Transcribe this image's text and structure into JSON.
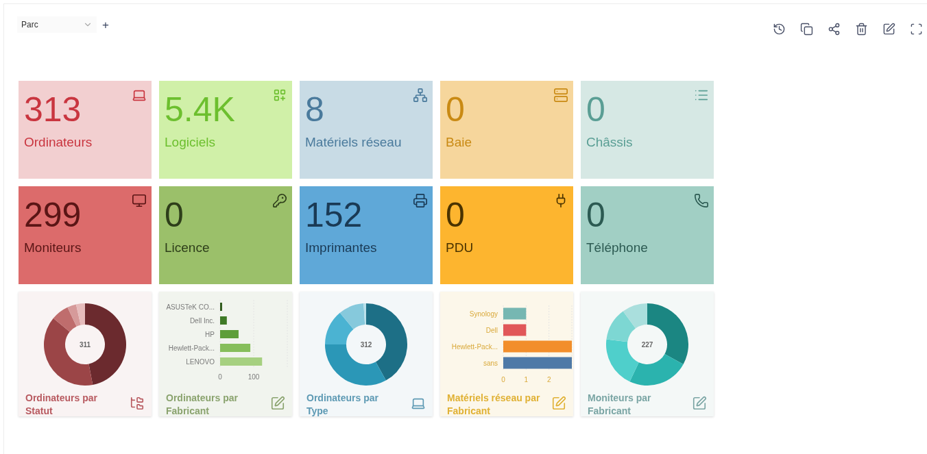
{
  "toolbar": {
    "dashboard_select": {
      "value": "Parc"
    },
    "add_button": "+"
  },
  "counters": [
    {
      "value": "313",
      "label": "Ordinateurs",
      "color": "#f2cfd0"
    },
    {
      "value": "5.4K",
      "label": "Logiciels",
      "color": "#d0f0a8"
    },
    {
      "value": "8",
      "label": "Matériels réseau",
      "color": "#c8dbe5"
    },
    {
      "value": "0",
      "label": "Baie",
      "color": "#f6d69c"
    },
    {
      "value": "0",
      "label": "Châssis",
      "color": "#d6e8e4"
    },
    {
      "value": "299",
      "label": "Moniteurs",
      "color": "#dc6b6b"
    },
    {
      "value": "0",
      "label": "Licence",
      "color": "#9bc06a"
    },
    {
      "value": "152",
      "label": "Imprimantes",
      "color": "#5fa8d8"
    },
    {
      "value": "0",
      "label": "PDU",
      "color": "#fdb52f"
    },
    {
      "value": "0",
      "label": "Téléphone",
      "color": "#a1cfc4"
    }
  ],
  "chart_cards": [
    {
      "kind": "donut",
      "title": "Ordinateurs par Statut",
      "center_label": "311",
      "color": "#f9f3f3"
    },
    {
      "kind": "bar",
      "title": "Ordinateurs par Fabricant",
      "color": "#f1f4ee",
      "chart_data": {
        "type": "bar",
        "orientation": "horizontal",
        "series": [
          {
            "name": "ASUSTeK CO...",
            "color": "#2f5a1c",
            "values": [
              6
            ]
          },
          {
            "name": "Dell Inc.",
            "color": "#3f7a27",
            "values": [
              20
            ]
          },
          {
            "name": "HP",
            "color": "#5e9e3a",
            "values": [
              55
            ]
          },
          {
            "name": "Hewlett-Pack...",
            "color": "#86be5b",
            "values": [
              90
            ]
          },
          {
            "name": "LENOVO",
            "color": "#a6d080",
            "values": [
              125
            ]
          }
        ],
        "xlim": [
          0,
          200
        ],
        "xticks": [
          0,
          100
        ]
      }
    },
    {
      "kind": "donut",
      "title": "Ordinateurs par Type",
      "center_label": "312",
      "color": "#f3f7f9"
    },
    {
      "kind": "bar",
      "title": "Matériels réseau par Fabricant",
      "color": "#fcf7ea",
      "chart_data": {
        "type": "bar",
        "orientation": "horizontal",
        "series": [
          {
            "name": "Synology",
            "color": "#76b7b2",
            "values": [
              1
            ]
          },
          {
            "name": "Dell",
            "color": "#e15759",
            "values": [
              1
            ]
          },
          {
            "name": "Hewlett-Pack...",
            "color": "#f28e2b",
            "values": [
              3
            ]
          },
          {
            "name": "sans",
            "color": "#4e79a7",
            "values": [
              3
            ]
          }
        ],
        "xlim": [
          0,
          3
        ],
        "xticks": [
          0,
          1,
          2
        ]
      }
    },
    {
      "kind": "donut",
      "title": "Moniteurs par Fabricant",
      "center_label": "227",
      "color": "#f4f8f7"
    }
  ]
}
